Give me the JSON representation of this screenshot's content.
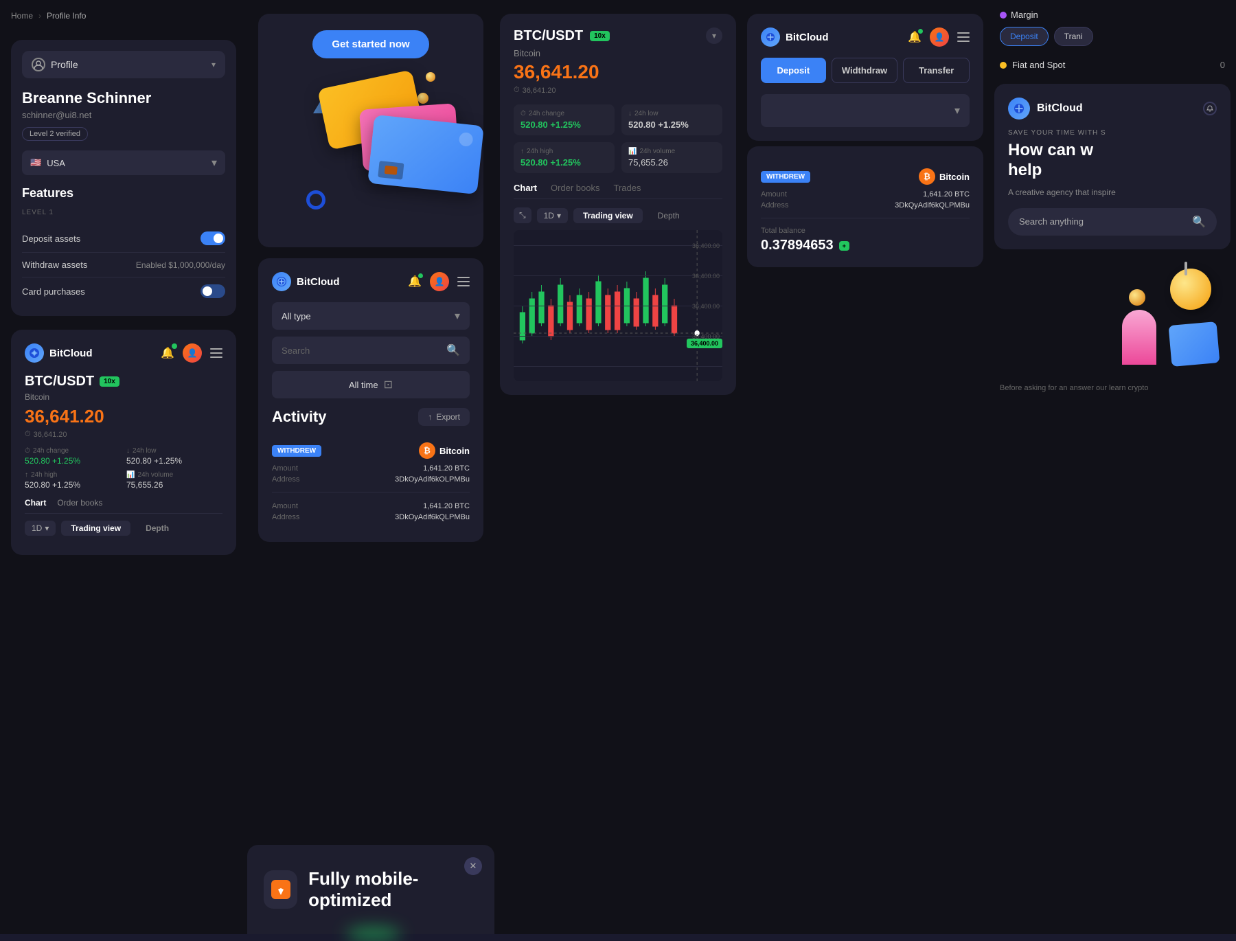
{
  "breadcrumb": {
    "home": "Home",
    "separator": "›",
    "current": "Profile Info"
  },
  "profile": {
    "label": "Profile",
    "name": "Breanne Schinner",
    "email": "schinner@ui8.net",
    "verified": "Level 2 verified",
    "country": "USA",
    "features_title": "Features",
    "level_label": "LEVEL 1",
    "features": [
      {
        "name": "Deposit assets",
        "type": "toggle_on"
      },
      {
        "name": "Withdraw assets",
        "value": "Enabled $1,000,000/day",
        "type": "text"
      },
      {
        "name": "Card purchases",
        "type": "toggle_partial"
      }
    ]
  },
  "bitcloud_mini": {
    "name": "BitCloud",
    "pair": "BTC/USDT",
    "leverage": "10x",
    "coin": "Bitcoin",
    "price": "36,641.20",
    "price_ref": "36,641.20",
    "change_label": "24h change",
    "change_val": "520.80 +1.25%",
    "low_label": "24h low",
    "low_val": "520.80 +1.25%",
    "high_label": "24h high",
    "high_val": "520.80 +1.25%",
    "vol_label": "24h volume",
    "vol_val": "75,655.26",
    "chart_tab": "Chart",
    "orderbooks_tab": "Order books"
  },
  "get_started": {
    "button": "Get started now"
  },
  "activity": {
    "title": "Activity",
    "export_btn": "Export",
    "type_filter": "All type",
    "search_placeholder": "Search",
    "time_filter": "All time",
    "transactions": [
      {
        "badge": "WITHDREW",
        "coin_icon": "₿",
        "coin": "Bitcoin",
        "amount_label": "Amount",
        "amount_val": "1,641.20 BTC",
        "address_label": "Address",
        "address_val": "3DkOyAdif6kOLPMBu"
      }
    ]
  },
  "btc_chart": {
    "pair": "BTC/USDT",
    "leverage": "10x",
    "coin": "Bitcoin",
    "price": "36,641.20",
    "price_ref": "36,641.20",
    "change_label": "24h change",
    "change_val": "520.80 +1.25%",
    "low_label": "24h low",
    "low_val": "520.80 +1.25%",
    "high_label": "24h high",
    "high_val": "520.80 +1.25%",
    "vol_label": "24h volume",
    "vol_val": "75,655.26",
    "nav_tabs": [
      "Chart",
      "Order books",
      "Trades"
    ],
    "time_btn": "1D",
    "view_btns": [
      "Trading view",
      "Depth"
    ],
    "price_level": "36,400.00"
  },
  "bitcloud_activity": {
    "name": "BitCloud",
    "dep_btn": "Deposit",
    "widthdraw_btn": "Widthdraw",
    "transfer_btn": "Transfer",
    "total_balance_label": "Total balance",
    "transactions": [
      {
        "badge": "WITHDREW",
        "coin_icon": "₿",
        "coin": "Bitcoin",
        "amount_label": "Amount",
        "amount_val": "1,641.20 BTC",
        "address_label": "Address",
        "address_val": "3DkOyAdif6kQLPMBu"
      }
    ]
  },
  "bitcloud_search": {
    "name": "BitCloud",
    "save_time": "SAVE YOUR TIME WITH S",
    "headline_line1": "How can w",
    "headline_line2": "help",
    "desc": "A creative agency that inspire",
    "search_placeholder": "Search anything"
  },
  "top_right": {
    "margin_label": "Margin",
    "deposit_btn": "Deposit",
    "transfer_btn": "Trani",
    "fiat_spot": "Fiat and Spot",
    "value": "0"
  },
  "mobile_banner": {
    "text": "Fully mobile-optimized"
  }
}
